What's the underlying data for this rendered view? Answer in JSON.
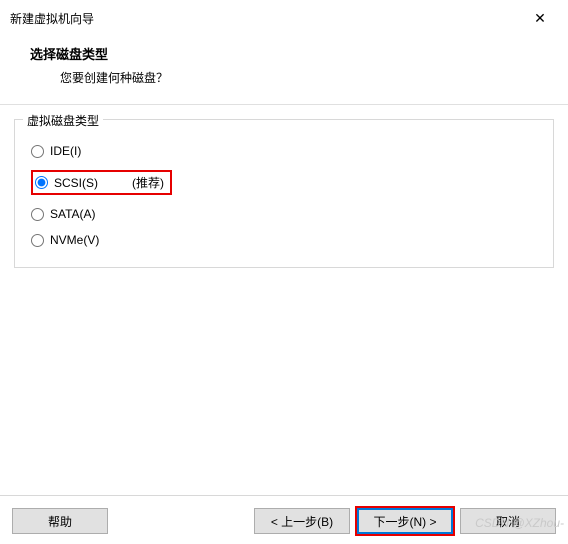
{
  "window": {
    "title": "新建虚拟机向导"
  },
  "header": {
    "title": "选择磁盘类型",
    "subtitle": "您要创建何种磁盘？"
  },
  "group": {
    "legend": "虚拟磁盘类型",
    "options": {
      "ide": "IDE(I)",
      "scsi": "SCSI(S)",
      "sata": "SATA(A)",
      "nvme": "NVMe(V)"
    },
    "recommend": "(推荐)"
  },
  "buttons": {
    "help": "帮助",
    "back": "< 上一步(B)",
    "next": "下一步(N) >",
    "cancel": "取消"
  },
  "watermark": "CSDN @XZhou-"
}
